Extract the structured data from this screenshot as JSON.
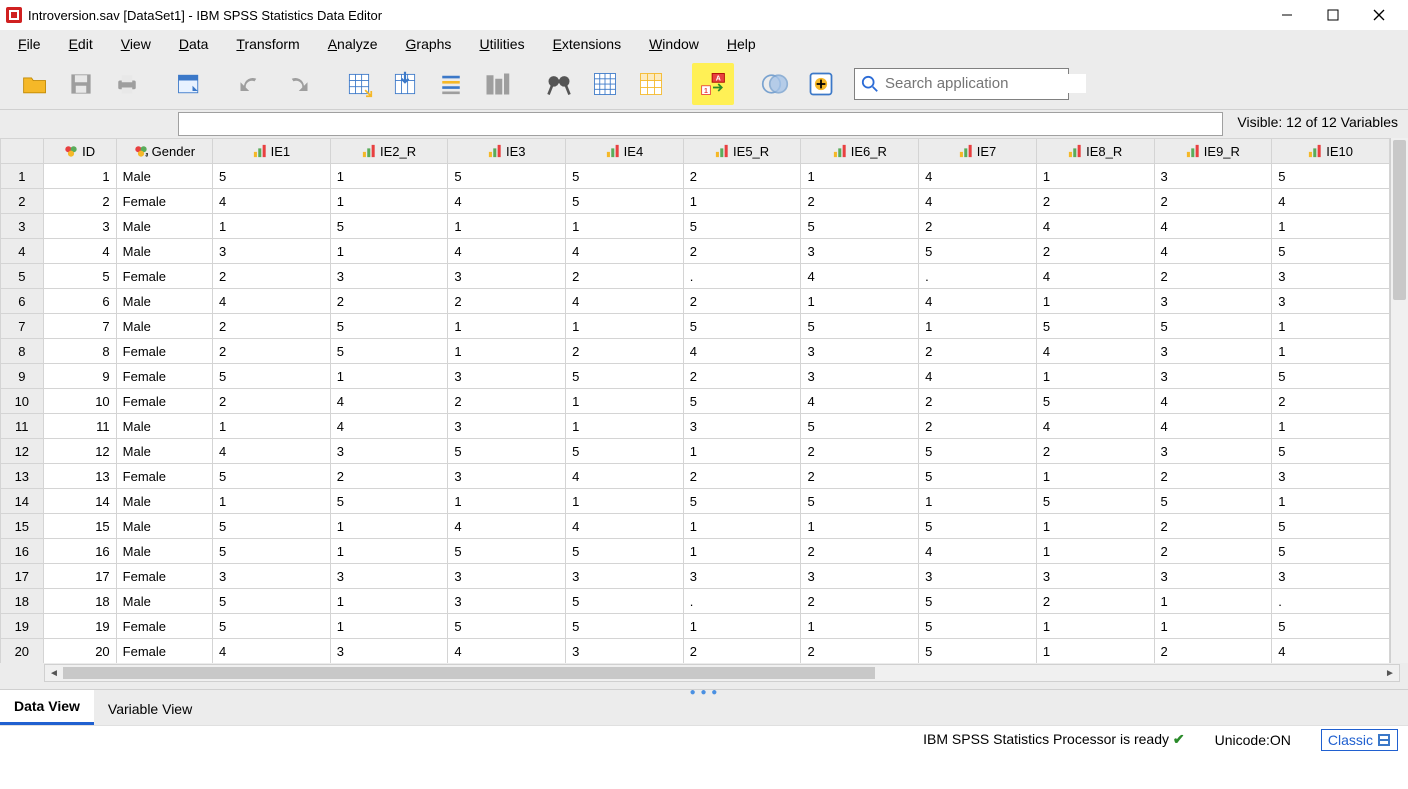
{
  "window": {
    "title": "Introversion.sav [DataSet1] - IBM SPSS Statistics Data Editor"
  },
  "menu": [
    {
      "u": "F",
      "rest": "ile"
    },
    {
      "u": "E",
      "rest": "dit"
    },
    {
      "u": "V",
      "rest": "iew"
    },
    {
      "u": "D",
      "rest": "ata"
    },
    {
      "u": "T",
      "rest": "ransform"
    },
    {
      "u": "A",
      "rest": "nalyze"
    },
    {
      "u": "G",
      "rest": "raphs"
    },
    {
      "u": "U",
      "rest": "tilities"
    },
    {
      "u": "E",
      "rest": "xtensions"
    },
    {
      "u": "W",
      "rest": "indow"
    },
    {
      "u": "H",
      "rest": "elp"
    }
  ],
  "search": {
    "placeholder": "Search application"
  },
  "visible_text": "Visible: 12 of 12 Variables",
  "columns": [
    {
      "name": "ID",
      "icon": "id"
    },
    {
      "name": "Gender",
      "icon": "gender"
    },
    {
      "name": "IE1",
      "icon": "scale"
    },
    {
      "name": "IE2_R",
      "icon": "scale"
    },
    {
      "name": "IE3",
      "icon": "scale"
    },
    {
      "name": "IE4",
      "icon": "scale"
    },
    {
      "name": "IE5_R",
      "icon": "scale"
    },
    {
      "name": "IE6_R",
      "icon": "scale"
    },
    {
      "name": "IE7",
      "icon": "scale"
    },
    {
      "name": "IE8_R",
      "icon": "scale"
    },
    {
      "name": "IE9_R",
      "icon": "scale"
    },
    {
      "name": "IE10",
      "icon": "scale"
    }
  ],
  "rows": [
    {
      "n": 1,
      "id": "1",
      "gender": "Male",
      "v": [
        "5",
        "1",
        "5",
        "5",
        "2",
        "1",
        "4",
        "1",
        "3",
        "5"
      ]
    },
    {
      "n": 2,
      "id": "2",
      "gender": "Female",
      "v": [
        "4",
        "1",
        "4",
        "5",
        "1",
        "2",
        "4",
        "2",
        "2",
        "4"
      ]
    },
    {
      "n": 3,
      "id": "3",
      "gender": "Male",
      "v": [
        "1",
        "5",
        "1",
        "1",
        "5",
        "5",
        "2",
        "4",
        "4",
        "1"
      ]
    },
    {
      "n": 4,
      "id": "4",
      "gender": "Male",
      "v": [
        "3",
        "1",
        "4",
        "4",
        "2",
        "3",
        "5",
        "2",
        "4",
        "5"
      ]
    },
    {
      "n": 5,
      "id": "5",
      "gender": "Female",
      "v": [
        "2",
        "3",
        "3",
        "2",
        ".",
        "4",
        ".",
        "4",
        "2",
        "3"
      ]
    },
    {
      "n": 6,
      "id": "6",
      "gender": "Male",
      "v": [
        "4",
        "2",
        "2",
        "4",
        "2",
        "1",
        "4",
        "1",
        "3",
        "3"
      ]
    },
    {
      "n": 7,
      "id": "7",
      "gender": "Male",
      "v": [
        "2",
        "5",
        "1",
        "1",
        "5",
        "5",
        "1",
        "5",
        "5",
        "1"
      ]
    },
    {
      "n": 8,
      "id": "8",
      "gender": "Female",
      "v": [
        "2",
        "5",
        "1",
        "2",
        "4",
        "3",
        "2",
        "4",
        "3",
        "1"
      ]
    },
    {
      "n": 9,
      "id": "9",
      "gender": "Female",
      "v": [
        "5",
        "1",
        "3",
        "5",
        "2",
        "3",
        "4",
        "1",
        "3",
        "5"
      ]
    },
    {
      "n": 10,
      "id": "10",
      "gender": "Female",
      "v": [
        "2",
        "4",
        "2",
        "1",
        "5",
        "4",
        "2",
        "5",
        "4",
        "2"
      ]
    },
    {
      "n": 11,
      "id": "11",
      "gender": "Male",
      "v": [
        "1",
        "4",
        "3",
        "1",
        "3",
        "5",
        "2",
        "4",
        "4",
        "1"
      ]
    },
    {
      "n": 12,
      "id": "12",
      "gender": "Male",
      "v": [
        "4",
        "3",
        "5",
        "5",
        "1",
        "2",
        "5",
        "2",
        "3",
        "5"
      ]
    },
    {
      "n": 13,
      "id": "13",
      "gender": "Female",
      "v": [
        "5",
        "2",
        "3",
        "4",
        "2",
        "2",
        "5",
        "1",
        "2",
        "3"
      ]
    },
    {
      "n": 14,
      "id": "14",
      "gender": "Male",
      "v": [
        "1",
        "5",
        "1",
        "1",
        "5",
        "5",
        "1",
        "5",
        "5",
        "1"
      ]
    },
    {
      "n": 15,
      "id": "15",
      "gender": "Male",
      "v": [
        "5",
        "1",
        "4",
        "4",
        "1",
        "1",
        "5",
        "1",
        "2",
        "5"
      ]
    },
    {
      "n": 16,
      "id": "16",
      "gender": "Male",
      "v": [
        "5",
        "1",
        "5",
        "5",
        "1",
        "2",
        "4",
        "1",
        "2",
        "5"
      ]
    },
    {
      "n": 17,
      "id": "17",
      "gender": "Female",
      "v": [
        "3",
        "3",
        "3",
        "3",
        "3",
        "3",
        "3",
        "3",
        "3",
        "3"
      ]
    },
    {
      "n": 18,
      "id": "18",
      "gender": "Male",
      "v": [
        "5",
        "1",
        "3",
        "5",
        ".",
        "2",
        "5",
        "2",
        "1",
        "."
      ]
    },
    {
      "n": 19,
      "id": "19",
      "gender": "Female",
      "v": [
        "5",
        "1",
        "5",
        "5",
        "1",
        "1",
        "5",
        "1",
        "1",
        "5"
      ]
    },
    {
      "n": 20,
      "id": "20",
      "gender": "Female",
      "v": [
        "4",
        "3",
        "4",
        "3",
        "2",
        "2",
        "5",
        "1",
        "2",
        "4"
      ]
    }
  ],
  "tabs": {
    "data": "Data View",
    "variable": "Variable View"
  },
  "status": {
    "processor": "IBM SPSS Statistics Processor is ready",
    "unicode": "Unicode:ON",
    "classic": "Classic"
  }
}
